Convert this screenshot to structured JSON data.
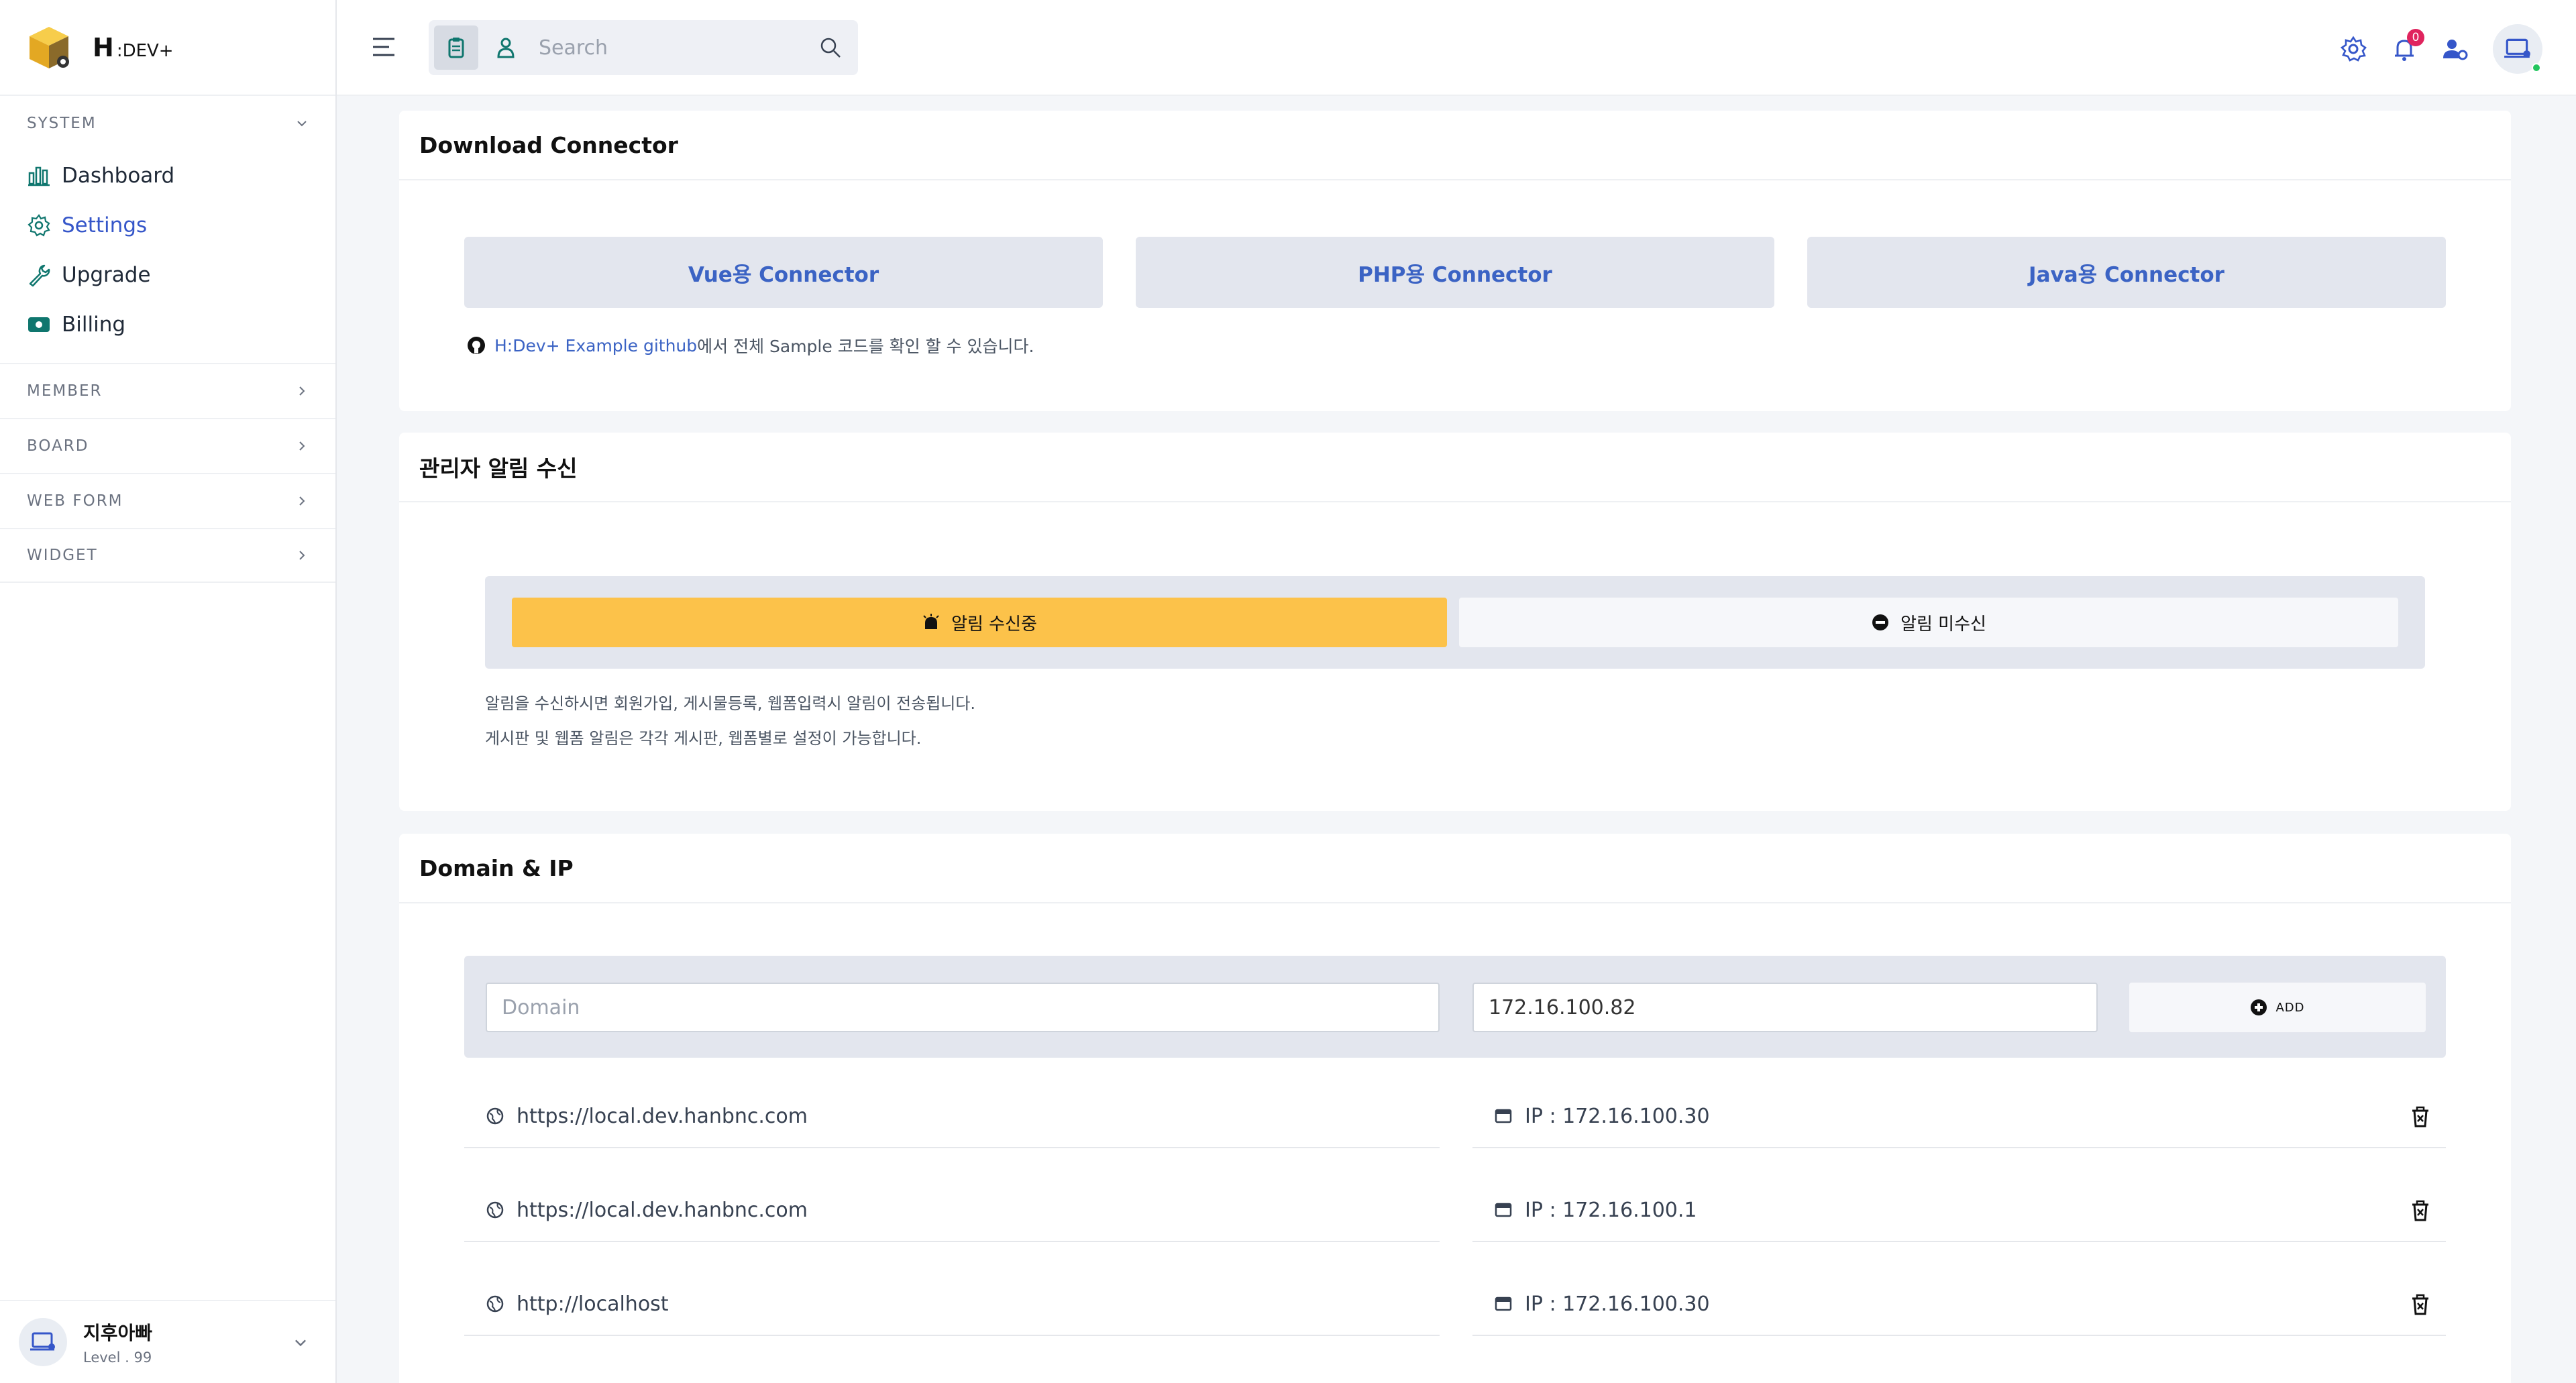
{
  "brand": {
    "letter": "H",
    "name": ":DEV+"
  },
  "sidebar": {
    "system_label": "SYSTEM",
    "items": [
      {
        "label": "Dashboard",
        "icon": "chart-bar-icon"
      },
      {
        "label": "Settings",
        "icon": "gear-icon",
        "active": true
      },
      {
        "label": "Upgrade",
        "icon": "wrench-icon"
      },
      {
        "label": "Billing",
        "icon": "money-icon"
      }
    ],
    "groups": [
      "MEMBER",
      "BOARD",
      "WEB FORM",
      "WIDGET"
    ]
  },
  "user": {
    "name": "지후아빠",
    "level": "Level . 99"
  },
  "topbar": {
    "search_placeholder": "Search",
    "notification_count": "0"
  },
  "download": {
    "title": "Download Connector",
    "buttons": [
      "Vue용 Connector",
      "PHP용 Connector",
      "Java용 Connector"
    ],
    "note_link": "H:Dev+ Example github",
    "note_text": "에서 전체 Sample 코드를 확인 할 수 있습니다."
  },
  "alerts": {
    "title": "관리자 알림 수신",
    "on_label": "알림 수신중",
    "off_label": "알림 미수신",
    "desc1": "알림을 수신하시면 회원가입, 게시물등록, 웹폼입력시 알림이 전송됩니다.",
    "desc2": "게시판 및 웹폼 알림은 각각 게시판, 웹폼별로 설정이 가능합니다."
  },
  "domain": {
    "title": "Domain & IP",
    "domain_placeholder": "Domain",
    "ip_value": "172.16.100.82",
    "add_label": "ADD",
    "rows": [
      {
        "domain": "https://local.dev.hanbnc.com",
        "ip": "IP : 172.16.100.30"
      },
      {
        "domain": "https://local.dev.hanbnc.com",
        "ip": "IP : 172.16.100.1"
      },
      {
        "domain": "http://localhost",
        "ip": "IP : 172.16.100.30"
      }
    ]
  },
  "colors": {
    "accent": "#3556c9",
    "alert_on": "#fcc24a",
    "badge": "#e0245e",
    "brand_cube": "#f2b632"
  }
}
